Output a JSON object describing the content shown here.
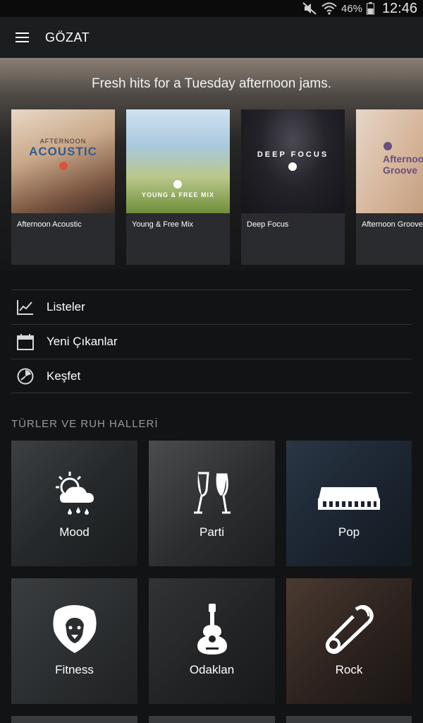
{
  "status": {
    "battery_pct": "46%",
    "time": "12:46"
  },
  "appbar": {
    "title": "GÖZAT",
    "menu_icon": "hamburger-menu-icon"
  },
  "hero": {
    "tagline": "Fresh hits for a Tuesday afternoon jams.",
    "cards": [
      {
        "name": "Afternoon Acoustic",
        "art_small": "AFTERNOON",
        "art_big": "ACOUSTIC"
      },
      {
        "name": "Young & Free Mix",
        "art_text": "YOUNG & FREE MIX"
      },
      {
        "name": "Deep Focus",
        "art_text": "DEEP FOCUS"
      },
      {
        "name": "Afternoon Groove",
        "art_text": "Afternoon Groove"
      }
    ]
  },
  "menu": [
    {
      "label": "Listeler",
      "icon": "chart-icon"
    },
    {
      "label": "Yeni Çıkanlar",
      "icon": "calendar-icon"
    },
    {
      "label": "Keşfet",
      "icon": "discover-icon"
    }
  ],
  "genres": {
    "title": "TÜRLER VE RUH HALLERİ",
    "tiles": [
      {
        "label": "Mood",
        "icon": "weather-icon"
      },
      {
        "label": "Parti",
        "icon": "champagne-icon"
      },
      {
        "label": "Pop",
        "icon": "keyboard-icon"
      },
      {
        "label": "Fitness",
        "icon": "lion-icon"
      },
      {
        "label": "Odaklan",
        "icon": "guitar-icon"
      },
      {
        "label": "Rock",
        "icon": "safety-pin-icon"
      }
    ]
  }
}
